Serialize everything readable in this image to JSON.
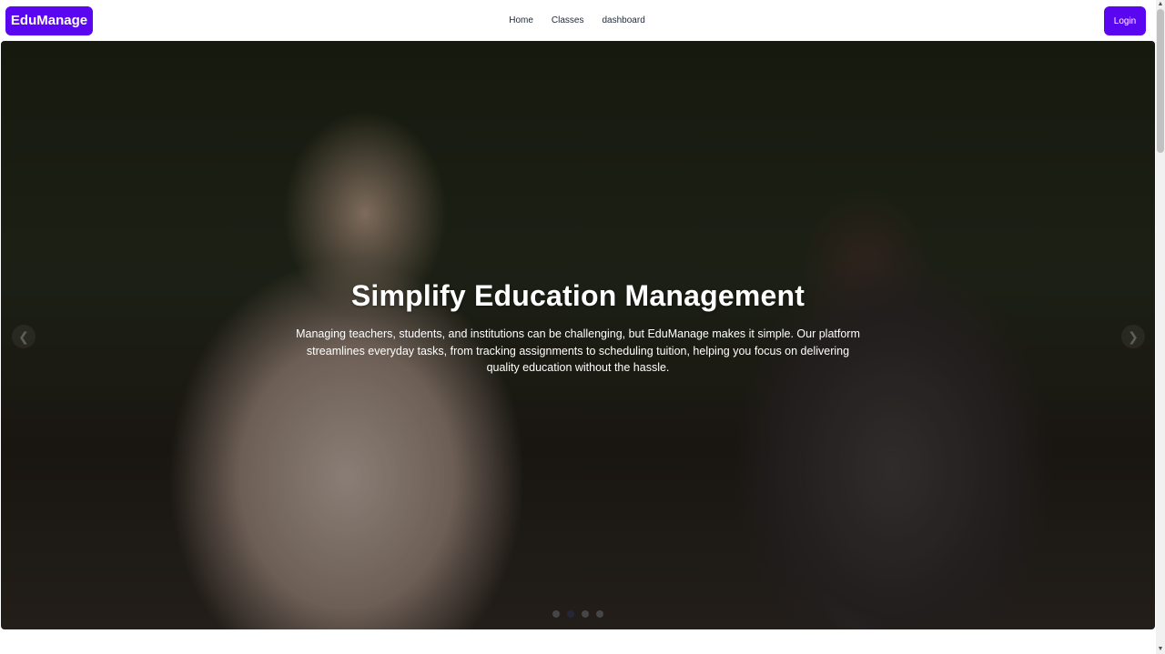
{
  "brand": "EduManage",
  "nav": {
    "links": [
      "Home",
      "Classes",
      "dashboard"
    ],
    "login_label": "Login"
  },
  "hero": {
    "title": "Simplify Education Management",
    "description": "Managing teachers, students, and institutions can be challenging, but EduManage makes it simple. Our platform streamlines everyday tasks, from tracking assignments to scheduling tuition, helping you focus on delivering quality education without the hassle.",
    "prev_icon": "❮",
    "next_icon": "❯",
    "slide_count": 4,
    "active_slide": 2
  },
  "colors": {
    "accent": "#5b06f0"
  },
  "scrollbar": {
    "up_icon": "▲",
    "down_icon": "▼"
  }
}
